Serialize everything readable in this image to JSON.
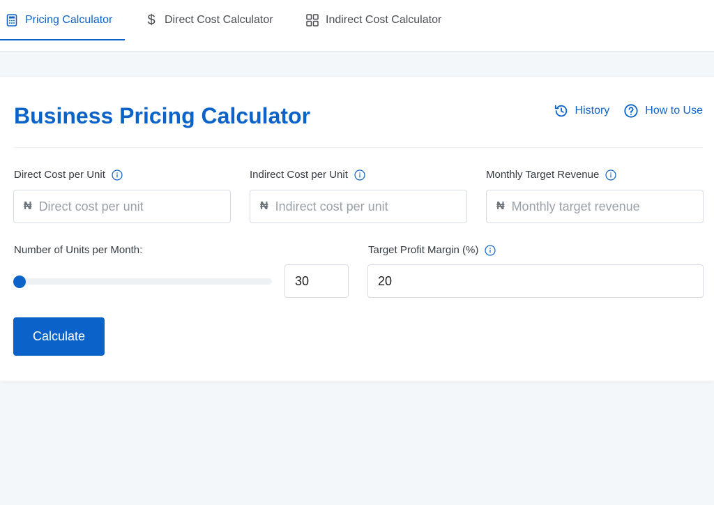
{
  "tabs": [
    {
      "label": "Pricing Calculator",
      "icon": "calculator-icon",
      "active": true
    },
    {
      "label": "Direct Cost Calculator",
      "icon": "dollar-icon",
      "active": false
    },
    {
      "label": "Indirect Cost Calculator",
      "icon": "grid-icon",
      "active": false
    }
  ],
  "header": {
    "title": "Business Pricing Calculator",
    "history_label": "History",
    "howto_label": "How to Use"
  },
  "fields": {
    "direct_cost": {
      "label": "Direct Cost per Unit",
      "placeholder": "Direct cost per unit",
      "value": "",
      "currency": "₦"
    },
    "indirect_cost": {
      "label": "Indirect Cost per Unit",
      "placeholder": "Indirect cost per unit",
      "value": "",
      "currency": "₦"
    },
    "monthly_revenue": {
      "label": "Monthly Target Revenue",
      "placeholder": "Monthly target revenue",
      "value": "",
      "currency": "₦"
    },
    "units_per_month": {
      "label": "Number of Units per Month:",
      "value": "30",
      "slider_fraction": 0.0
    },
    "profit_margin": {
      "label": "Target Profit Margin (%)",
      "value": "20"
    }
  },
  "actions": {
    "calculate_label": "Calculate"
  },
  "colors": {
    "accent": "#0b63c9",
    "background": "#f4f7fa",
    "card": "#ffffff"
  }
}
